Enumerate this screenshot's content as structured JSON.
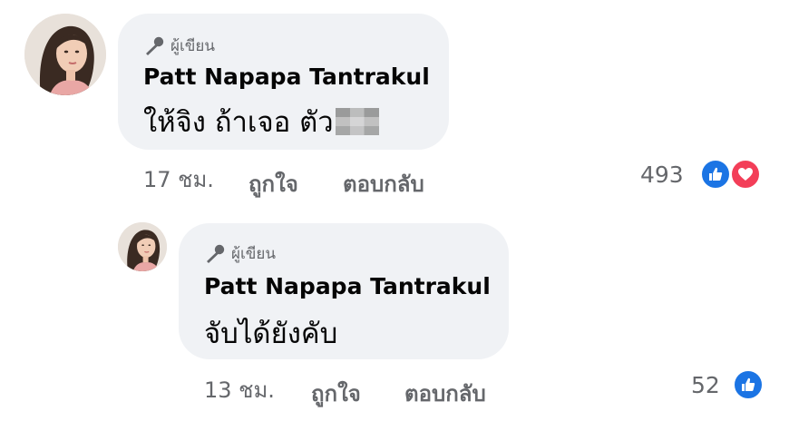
{
  "comments": [
    {
      "author_badge": "ผู้เขียน",
      "author_name": "Patt Napapa Tantrakul",
      "text": "ให้จิง ถ้าเจอ ตัว",
      "time": "17 ชม.",
      "like_label": "ถูกใจ",
      "reply_label": "ตอบกลับ",
      "reaction_count": "493",
      "reactions": [
        "like-icon",
        "love-icon"
      ]
    },
    {
      "author_badge": "ผู้เขียน",
      "author_name": "Patt Napapa Tantrakul",
      "text": "จับได้ยังคับ",
      "time": "13 ชม.",
      "like_label": "ถูกใจ",
      "reply_label": "ตอบกลับ",
      "reaction_count": "52",
      "reactions": [
        "like-icon"
      ]
    }
  ],
  "colors": {
    "bubble": "#f0f2f5",
    "meta_text": "#65676b",
    "like": "#1b74e4",
    "love": "#f33e58"
  }
}
